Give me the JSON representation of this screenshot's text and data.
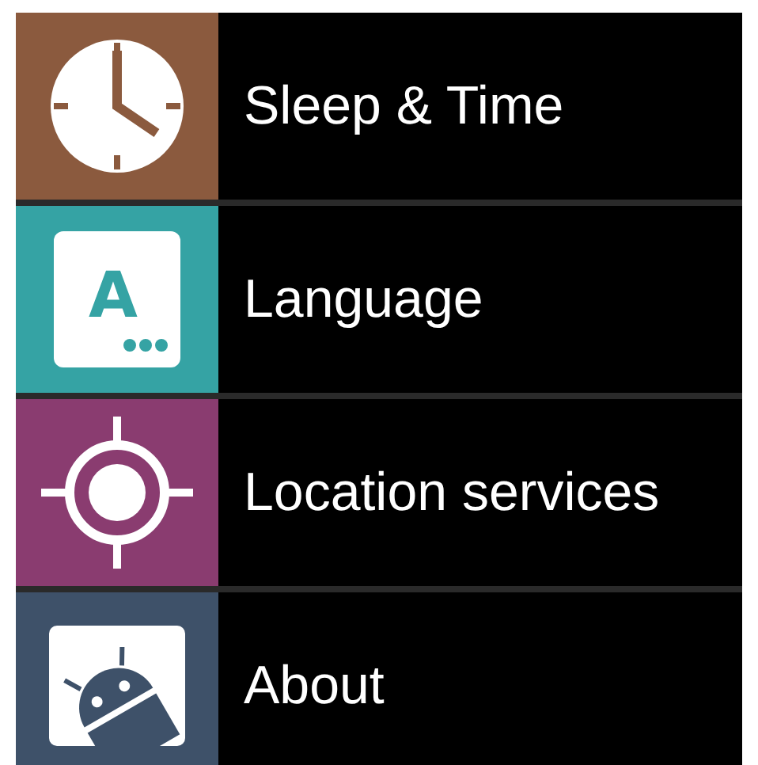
{
  "settings_items": [
    {
      "kind": "clock",
      "label": "Sleep & Time",
      "color": "#8b5a3e"
    },
    {
      "kind": "language",
      "label": "Language",
      "color": "#35a3a4",
      "icon_letter": "A"
    },
    {
      "kind": "location",
      "label": "Location services",
      "color": "#8a3c70"
    },
    {
      "kind": "about",
      "label": "About",
      "color": "#3e5169"
    }
  ]
}
